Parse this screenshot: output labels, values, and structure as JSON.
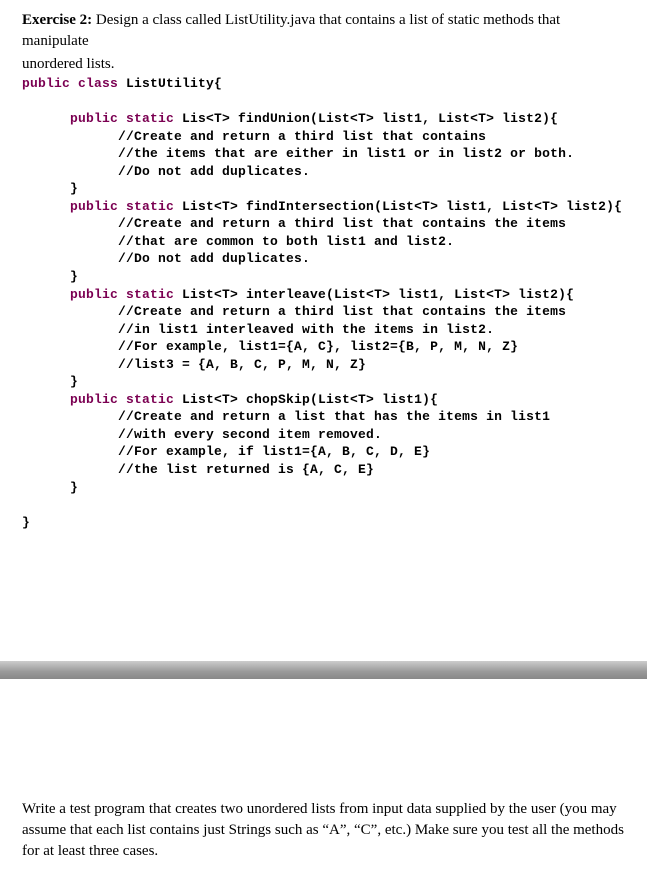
{
  "header": {
    "label": "Exercise 2:",
    "desc1": " Design a class called ListUtility.java that contains a list of static methods that manipulate",
    "desc2": "unordered lists."
  },
  "code": {
    "l1a": "public",
    "l1b": " class",
    "l1c": " ListUtility{",
    "m1sig_a": "      public",
    "m1sig_b": " static",
    "m1sig_c": " Lis<T> findUnion(List<T> list1, List<T> list2){",
    "m1c1": "            //Create and return a third list that contains",
    "m1c2": "            //the items that are either in list1 or in list2 or both.",
    "m1c3": "            //Do not add duplicates.",
    "m1close": "      }",
    "m2sig_a": "      public",
    "m2sig_b": " static",
    "m2sig_c": " List<T> findIntersection(List<T> list1, List<T> list2){",
    "m2c1": "            //Create and return a third list that contains the items",
    "m2c2": "            //that are common to both list1 and list2.",
    "m2c3": "            //Do not add duplicates.",
    "m2close": "      }",
    "m3sig_a": "      public",
    "m3sig_b": " static",
    "m3sig_c": " List<T> interleave(List<T> list1, List<T> list2){",
    "m3c1": "            //Create and return a third list that contains the items",
    "m3c2": "            //in list1 interleaved with the items in list2.",
    "m3c3": "            //For example, list1={A, C}, list2={B, P, M, N, Z}",
    "m3c4": "            //list3 = {A, B, C, P, M, N, Z}",
    "m3close": "      }",
    "m4sig_a": "      public",
    "m4sig_b": " static",
    "m4sig_c": " List<T> chopSkip(List<T> list1){",
    "m4c1": "            //Create and return a list that has the items in list1",
    "m4c2": "            //with every second item removed.",
    "m4c3": "            //For example, if list1={A, B, C, D, E}",
    "m4c4": "            //the list returned is {A, C, E}",
    "m4close": "      }",
    "classclose": "}"
  },
  "footer": {
    "p1": "Write a test program that creates two unordered lists from input data supplied by the user (you may",
    "p2": "assume that each list contains just Strings such as “A”, “C”, etc.) Make sure you test all the methods",
    "p3": "for at least three cases."
  }
}
